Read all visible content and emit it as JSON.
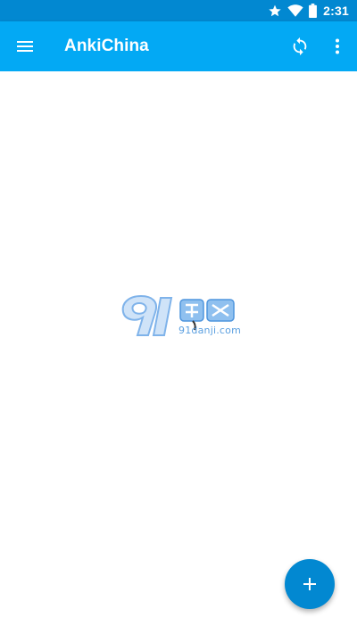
{
  "status_bar": {
    "time": "2:31",
    "icons": [
      "star-icon",
      "wifi-icon",
      "battery-icon"
    ]
  },
  "app_bar": {
    "title": "AnkiChina",
    "nav_icon": "menu-icon",
    "actions": [
      "sync-icon",
      "more-vert-icon"
    ]
  },
  "watermark": {
    "text": "91danji.com"
  },
  "fab": {
    "icon": "plus-icon"
  },
  "colors": {
    "status_bar": "#0288d1",
    "app_bar": "#03a9f4",
    "fab": "#0288d1",
    "background": "#ffffff"
  }
}
